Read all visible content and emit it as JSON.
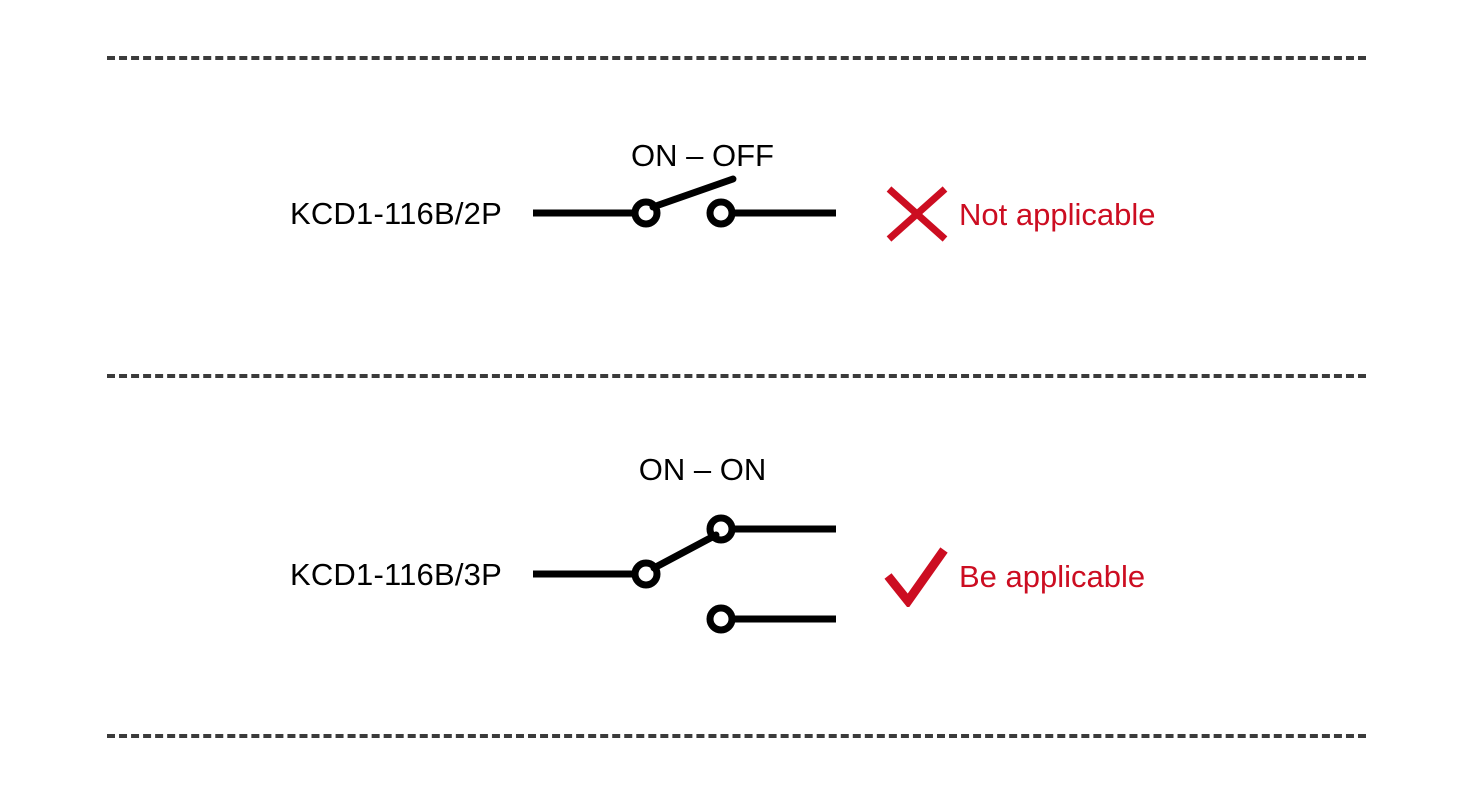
{
  "page": {
    "title": "Rocker switch wiring applicability chart",
    "background_color": "#ffffff",
    "line_color": "#000000",
    "accent_red": "#CC0D21",
    "divider_color": "#3b3b3b"
  },
  "dividers": [
    {
      "name": "top-divider"
    },
    {
      "name": "middle-divider"
    },
    {
      "name": "bottom-divider"
    }
  ],
  "rows": [
    {
      "part_number": "KCD1-116B/2P",
      "mode": "ON – OFF",
      "symbol": "spst-open-switch-symbol",
      "verdict_mark": "x-mark-icon",
      "verdict_text": "Not applicable",
      "verdict_color": "#CC0D21"
    },
    {
      "part_number": "KCD1-116B/3P",
      "mode": "ON – ON",
      "symbol": "spdt-switch-symbol",
      "verdict_mark": "check-mark-icon",
      "verdict_text": "Be applicable",
      "verdict_color": "#CC0D21"
    }
  ]
}
